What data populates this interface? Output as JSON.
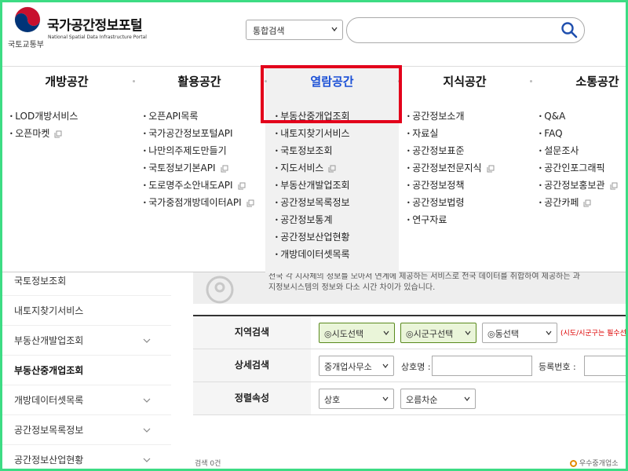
{
  "header": {
    "ministry": "국토교통부",
    "title": "국가공간정보포털",
    "subtitle": "National Spatial Data Infrastructure Portal",
    "search_scope": "통합검색",
    "search_placeholder": ""
  },
  "colors": {
    "accent": "#1a4fd6",
    "highlight": "#e3001b",
    "frame": "#3ddc84"
  },
  "menu": [
    {
      "label": "개방공간",
      "items": [
        {
          "text": "LOD개방서비스"
        },
        {
          "text": "오픈마켓",
          "copy": true
        }
      ]
    },
    {
      "label": "활용공간",
      "items": [
        {
          "text": "오픈API목록"
        },
        {
          "text": "국가공간정보포털API"
        },
        {
          "text": "나만의주제도만들기"
        },
        {
          "text": "국토정보기본API",
          "copy": true
        },
        {
          "text": "도로명주소안내도API",
          "copy": true
        },
        {
          "text": "국가중점개방데이터API",
          "copy": true
        }
      ]
    },
    {
      "label": "열람공간",
      "items": [
        {
          "text": "부동산중개업조회"
        },
        {
          "text": "내토지찾기서비스"
        },
        {
          "text": "국토정보조회"
        },
        {
          "text": "지도서비스",
          "copy": true
        },
        {
          "text": "부동산개발업조회"
        },
        {
          "text": "공간정보목록정보"
        },
        {
          "text": "공간정보통계"
        },
        {
          "text": "공간정보산업현황"
        },
        {
          "text": "개방데이터셋목록"
        }
      ]
    },
    {
      "label": "지식공간",
      "items": [
        {
          "text": "공간정보소개"
        },
        {
          "text": "자료실"
        },
        {
          "text": "공간정보표준"
        },
        {
          "text": "공간정보전문지식",
          "copy": true
        },
        {
          "text": "공간정보정책"
        },
        {
          "text": "공간정보법령"
        },
        {
          "text": "연구자료"
        }
      ]
    },
    {
      "label": "소통공간",
      "items": [
        {
          "text": "Q&A"
        },
        {
          "text": "FAQ"
        },
        {
          "text": "설문조사"
        },
        {
          "text": "공간인포그래픽"
        },
        {
          "text": "공간정보홍보관",
          "copy": true
        },
        {
          "text": "공간카페",
          "copy": true
        }
      ]
    }
  ],
  "sidebar": [
    {
      "label": "국토정보조회",
      "chevron": false
    },
    {
      "label": "내토지찾기서비스",
      "chevron": false
    },
    {
      "label": "부동산개발업조회",
      "chevron": true
    },
    {
      "label": "부동산중개업조회",
      "chevron": false,
      "active": true
    },
    {
      "label": "개방데이터셋목록",
      "chevron": true
    },
    {
      "label": "공간정보목록정보",
      "chevron": true
    },
    {
      "label": "공간정보산업현황",
      "chevron": true
    }
  ],
  "notice": {
    "line1": "전국 각 지자체의 정보를 모아서 연계에 제공하는 서비스로 전국 데이터를 취합하여 제공하는 과",
    "line2": "지정보시스템의 정보와 다소 시간 차이가 있습니다."
  },
  "form": {
    "region": {
      "label": "지역검색",
      "sido": "◎시도선택",
      "sigungu": "◎시군구선택",
      "dong": "◎동선택",
      "required_note": "(시도/시군구는 필수선"
    },
    "detail": {
      "label": "상세검색",
      "type": "중개업사무소",
      "name_label": "상호명 :",
      "reg_label": "등록번호 :"
    },
    "sort": {
      "label": "정렬속성",
      "field": "상호",
      "order": "오름차순"
    }
  },
  "footer": {
    "left": "검색 0건",
    "right": "우수중개업소"
  }
}
